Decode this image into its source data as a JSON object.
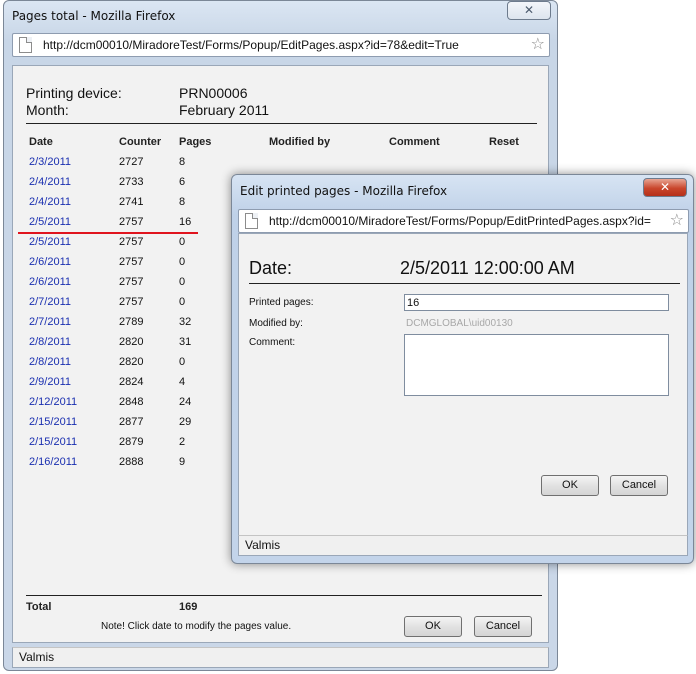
{
  "back_window": {
    "title": "Pages total - Mozilla Firefox",
    "close_glyph": "✕",
    "url": "http://dcm00010/MiradoreTest/Forms/Popup/EditPages.aspx?id=78&edit=True",
    "printing_device_label": "Printing device:",
    "printing_device_value": "PRN00006",
    "month_label": "Month:",
    "month_value": "February 2011",
    "columns": [
      "Date",
      "Counter",
      "Pages",
      "Modified by",
      "Comment",
      "Reset"
    ],
    "rows": [
      {
        "date": "2/3/2011",
        "counter": "2727",
        "pages": "8"
      },
      {
        "date": "2/4/2011",
        "counter": "2733",
        "pages": "6"
      },
      {
        "date": "2/4/2011",
        "counter": "2741",
        "pages": "8"
      },
      {
        "date": "2/5/2011",
        "counter": "2757",
        "pages": "16"
      },
      {
        "date": "2/5/2011",
        "counter": "2757",
        "pages": "0"
      },
      {
        "date": "2/6/2011",
        "counter": "2757",
        "pages": "0"
      },
      {
        "date": "2/6/2011",
        "counter": "2757",
        "pages": "0"
      },
      {
        "date": "2/7/2011",
        "counter": "2757",
        "pages": "0"
      },
      {
        "date": "2/7/2011",
        "counter": "2789",
        "pages": "32"
      },
      {
        "date": "2/8/2011",
        "counter": "2820",
        "pages": "31"
      },
      {
        "date": "2/8/2011",
        "counter": "2820",
        "pages": "0"
      },
      {
        "date": "2/9/2011",
        "counter": "2824",
        "pages": "4"
      },
      {
        "date": "2/12/2011",
        "counter": "2848",
        "pages": "24"
      },
      {
        "date": "2/15/2011",
        "counter": "2877",
        "pages": "29"
      },
      {
        "date": "2/15/2011",
        "counter": "2879",
        "pages": "2"
      },
      {
        "date": "2/16/2011",
        "counter": "2888",
        "pages": "9"
      }
    ],
    "total_label": "Total",
    "total_value": "169",
    "note": "Note! Click date to modify the pages value.",
    "ok_label": "OK",
    "cancel_label": "Cancel",
    "status": "Valmis",
    "highlight_color": "#e0141e"
  },
  "front_window": {
    "title": "Edit printed pages - Mozilla Firefox",
    "close_glyph": "✕",
    "url": "http://dcm00010/MiradoreTest/Forms/Popup/EditPrintedPages.aspx?id=",
    "date_label": "Date:",
    "date_value": "2/5/2011 12:00:00 AM",
    "printed_pages_label": "Printed pages:",
    "printed_pages_value": "16",
    "modified_by_label": "Modified by:",
    "modified_by_value": "DCMGLOBAL\\uid00130",
    "comment_label": "Comment:",
    "comment_value": "",
    "ok_label": "OK",
    "cancel_label": "Cancel",
    "status": "Valmis"
  }
}
